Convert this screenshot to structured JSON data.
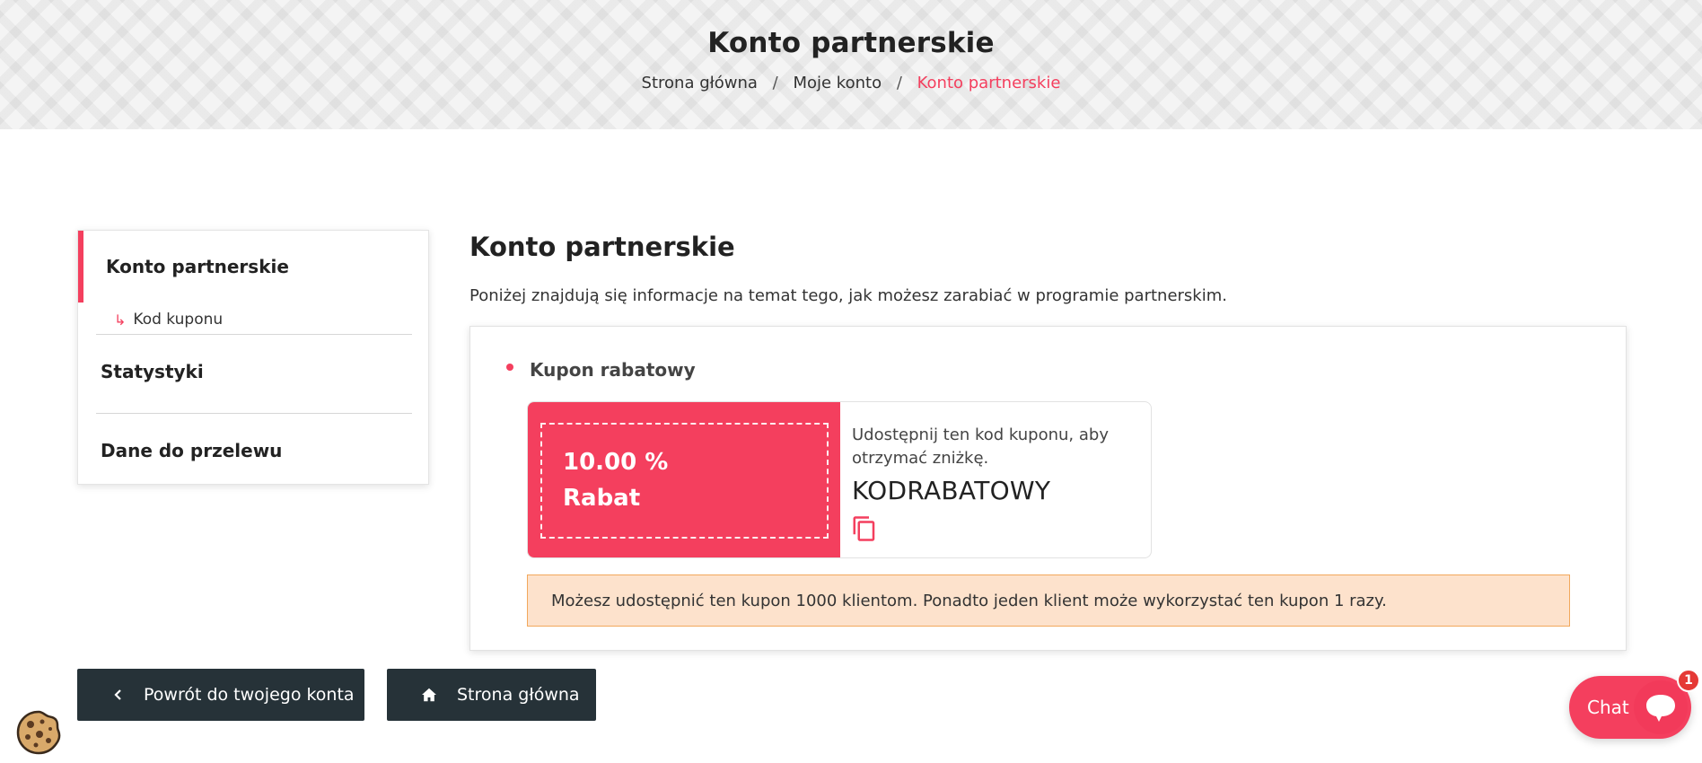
{
  "header": {
    "title": "Konto partnerskie",
    "breadcrumb": {
      "home": "Strona główna",
      "account": "Moje konto",
      "current": "Konto partnerskie",
      "separator": "/"
    }
  },
  "sidebar": {
    "active_item": "Konto partnerskie",
    "sub_item": "Kod kuponu",
    "items": [
      {
        "label": "Statystyki"
      },
      {
        "label": "Dane do przelewu"
      }
    ]
  },
  "main": {
    "title": "Konto partnerskie",
    "description": "Poniżej znajdują się informacje na temat tego, jak możesz zarabiać w programie partnerskim.",
    "coupon_section": {
      "heading": "Kupon rabatowy",
      "discount_value": "10.00 %",
      "discount_label": "Rabat",
      "share_info": "Udostępnij ten kod kuponu, aby otrzymać zniżkę.",
      "code": "KODRABATOWY",
      "copy_icon": "copy-icon",
      "notice": "Możesz udostępnić ten kupon 1000 klientom. Ponadto jeden klient może wykorzystać ten kupon 1 razy."
    }
  },
  "buttons": {
    "back_label": "Powrót do twojego konta",
    "home_label": "Strona główna"
  },
  "chat": {
    "label": "Chat",
    "badge_count": "1"
  },
  "colors": {
    "accent": "#f43f5e",
    "dark_button": "#263238",
    "notice_bg": "#fde2cc",
    "notice_border": "#f2a85c"
  }
}
